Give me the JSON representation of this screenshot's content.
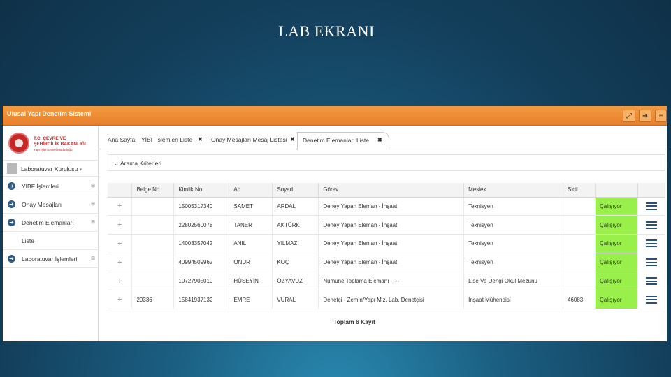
{
  "slide_title": "LAB EKRANI",
  "app": {
    "title": "Ulusal Yapı Denetim Sistemi",
    "buttons": [
      {
        "name": "fullscreen-icon",
        "glyph": "⤢"
      },
      {
        "name": "logout-icon",
        "glyph": "➜"
      },
      {
        "name": "menu-icon",
        "glyph": "≡"
      }
    ]
  },
  "logo": {
    "line1": "T.C. ÇEVRE VE",
    "line2": "ŞEHİRCİLİK BAKANLIĞI",
    "line3": "Yapı İşleri Genel Müdürlüğü"
  },
  "user": {
    "name": "Laboratuvar Kuruluşu",
    "caret": "▾"
  },
  "sidebar": {
    "items": [
      {
        "label": "YİBF İşlemleri",
        "badge": "⊞"
      },
      {
        "label": "Onay Mesajları",
        "badge": "⊞"
      },
      {
        "label": "Denetim Elemanları",
        "badge": "⊞"
      },
      {
        "label": "Laboratuvar İşlemleri",
        "badge": "⊞"
      }
    ],
    "sub_items": [
      {
        "label": "Liste"
      }
    ]
  },
  "tabs": [
    {
      "label": "Ana Sayfa"
    },
    {
      "label": "YİBF İşlemleri Liste",
      "close": "✖"
    },
    {
      "label": "Onay Mesajları Mesaj Listesi",
      "close": "✖"
    },
    {
      "label": "Denetim Elemanları Liste",
      "close": "✖"
    }
  ],
  "search": {
    "label": "⌄ Arama Kriterleri"
  },
  "table": {
    "columns": [
      "",
      "Belge No",
      "Kimlik No",
      "Ad",
      "Soyad",
      "Görev",
      "Meslek",
      "Sicil",
      "",
      ""
    ],
    "rows": [
      {
        "plus": "+",
        "belge_no": "",
        "kimlik_no": "15005317340",
        "ad": "SAMET",
        "soyad": "ARDAL",
        "gorev": "Deney Yapan Eleman - İnşaat",
        "meslek": "Teknisyen",
        "sicil": "",
        "durum": "Çalışıyor"
      },
      {
        "plus": "+",
        "belge_no": "",
        "kimlik_no": "22802560078",
        "ad": "TANER",
        "soyad": "AKTÜRK",
        "gorev": "Deney Yapan Eleman - İnşaat",
        "meslek": "Teknisyen",
        "sicil": "",
        "durum": "Çalışıyor"
      },
      {
        "plus": "+",
        "belge_no": "",
        "kimlik_no": "14003357042",
        "ad": "ANIL",
        "soyad": "YILMAZ",
        "gorev": "Deney Yapan Eleman - İnşaat",
        "meslek": "Teknisyen",
        "sicil": "",
        "durum": "Çalışıyor"
      },
      {
        "plus": "+",
        "belge_no": "",
        "kimlik_no": "40994509962",
        "ad": "ONUR",
        "soyad": "KOÇ",
        "gorev": "Deney Yapan Eleman - İnşaat",
        "meslek": "Teknisyen",
        "sicil": "",
        "durum": "Çalışıyor"
      },
      {
        "plus": "+",
        "belge_no": "",
        "kimlik_no": "10727905010",
        "ad": "HÜSEYİN",
        "soyad": "ÖZYAVUZ",
        "gorev": "Numune Toplama Elemanı - ---",
        "meslek": "Lise Ve Dengi Okul Mezunu",
        "sicil": "",
        "durum": "Çalışıyor"
      },
      {
        "plus": "+",
        "belge_no": "20336",
        "kimlik_no": "15841937132",
        "ad": "EMRE",
        "soyad": "VURAL",
        "gorev": "Denetçi - Zemin/Yapı Mlz. Lab. Denetçisi",
        "meslek": "İnşaat Mühendisi",
        "sicil": "46083",
        "durum": "Çalışıyor"
      }
    ],
    "total": "Toplam 6 Kayıt"
  },
  "colors": {
    "header": "#e8802a",
    "status_active": "#9af04a",
    "accent": "#2c5d8a"
  }
}
